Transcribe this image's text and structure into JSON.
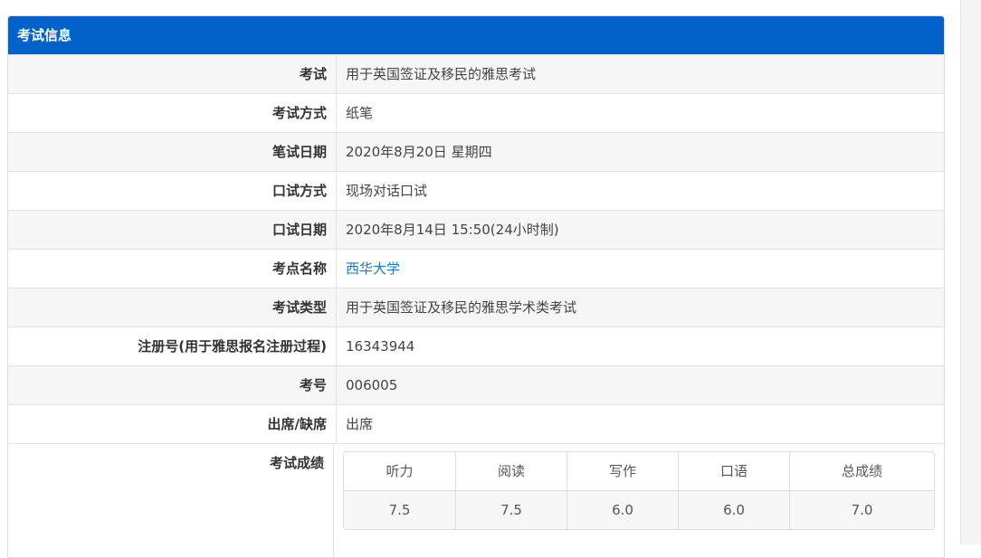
{
  "panel": {
    "title": "考试信息"
  },
  "rows": [
    {
      "key": "考试",
      "value": "用于英国签证及移民的雅思考试"
    },
    {
      "key": "考试方式",
      "value": "纸笔"
    },
    {
      "key": "笔试日期",
      "value": "2020年8月20日 星期四"
    },
    {
      "key": "口试方式",
      "value": "现场对话口试"
    },
    {
      "key": "口试日期",
      "value": "2020年8月14日 15:50(24小时制)"
    },
    {
      "key": "考点名称",
      "value": "西华大学"
    },
    {
      "key": "考试类型",
      "value": "用于英国签证及移民的雅思学术类考试"
    },
    {
      "key": "注册号(用于雅思报名注册过程)",
      "value": "16343944"
    },
    {
      "key": "考号",
      "value": "006005"
    },
    {
      "key": "出席/缺席",
      "value": "出席"
    }
  ],
  "scores": {
    "key": "考试成绩",
    "headers": [
      "听力",
      "阅读",
      "写作",
      "口语",
      "总成绩"
    ],
    "values": [
      "7.5",
      "7.5",
      "6.0",
      "6.0",
      "7.0"
    ]
  },
  "colors": {
    "header_bg": "#0262c9",
    "link": "#1a78c2"
  }
}
